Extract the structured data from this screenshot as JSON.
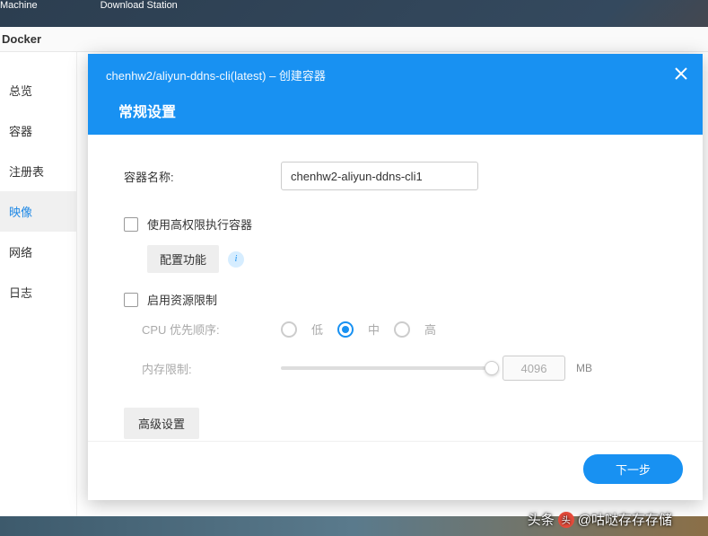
{
  "topbar": {
    "items": [
      "Machine",
      "Download Station"
    ]
  },
  "docker": {
    "title": "Docker",
    "sidebar": {
      "items": [
        {
          "label": "总览",
          "active": false
        },
        {
          "label": "容器",
          "active": false
        },
        {
          "label": "注册表",
          "active": false
        },
        {
          "label": "映像",
          "active": true
        },
        {
          "label": "网络",
          "active": false
        },
        {
          "label": "日志",
          "active": false
        }
      ]
    }
  },
  "modal": {
    "breadcrumb": "chenhw2/aliyun-ddns-cli(latest) – 创建容器",
    "title": "常规设置",
    "container_name_label": "容器名称:",
    "container_name_value": "chenhw2-aliyun-ddns-cli1",
    "high_priv_label": "使用高权限执行容器",
    "config_func_label": "配置功能",
    "resource_limit_label": "启用资源限制",
    "cpu_priority_label": "CPU 优先顺序:",
    "cpu_options": {
      "low": "低",
      "mid": "中",
      "high": "高"
    },
    "cpu_selected": "mid",
    "mem_limit_label": "内存限制:",
    "mem_value": "4096",
    "mem_unit": "MB",
    "advanced_label": "高级设置",
    "next_label": "下一步"
  },
  "watermark": {
    "prefix": "头条",
    "text": "@咕哒存存存储"
  }
}
